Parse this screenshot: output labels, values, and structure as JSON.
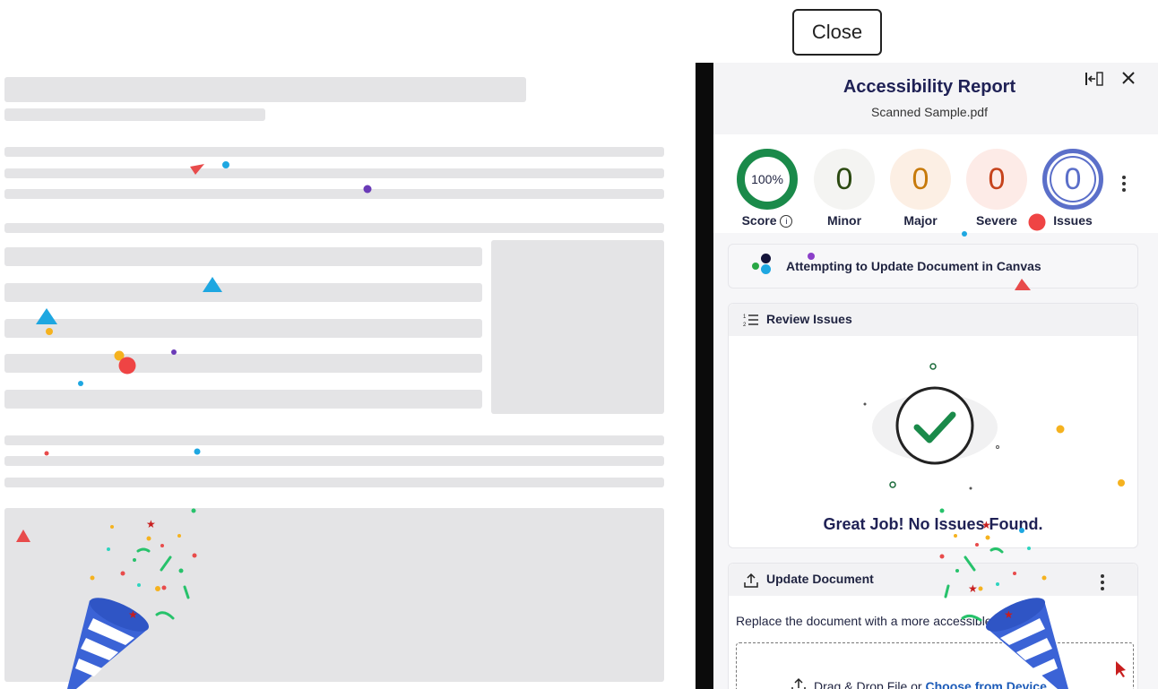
{
  "top_close_label": "Close",
  "panel": {
    "title": "Accessibility Report",
    "subtitle": "Scanned Sample.pdf",
    "collapse_icon": "collapse-panel-icon",
    "close_icon": "close-icon"
  },
  "stats": {
    "score": {
      "value": "100%",
      "label": "Score",
      "percent": 100,
      "color": "#1a8a4a"
    },
    "minor": {
      "value": "0",
      "label": "Minor",
      "color": "#2c4a12"
    },
    "major": {
      "value": "0",
      "label": "Major",
      "color": "#c77a0b"
    },
    "severe": {
      "value": "0",
      "label": "Severe",
      "color": "#c6431c"
    },
    "issues": {
      "value": "0",
      "label": "Issues",
      "color": "#5b6fc9"
    }
  },
  "status_banner": {
    "text": "Attempting to Update Document in Canvas"
  },
  "review": {
    "title": "Review Issues",
    "message": "Great Job! No Issues Found."
  },
  "update": {
    "title": "Update Document",
    "description": "Replace the document with a more accessible version.",
    "drop_text": "Drag & Drop File or ",
    "choose_link": "Choose from Device"
  }
}
